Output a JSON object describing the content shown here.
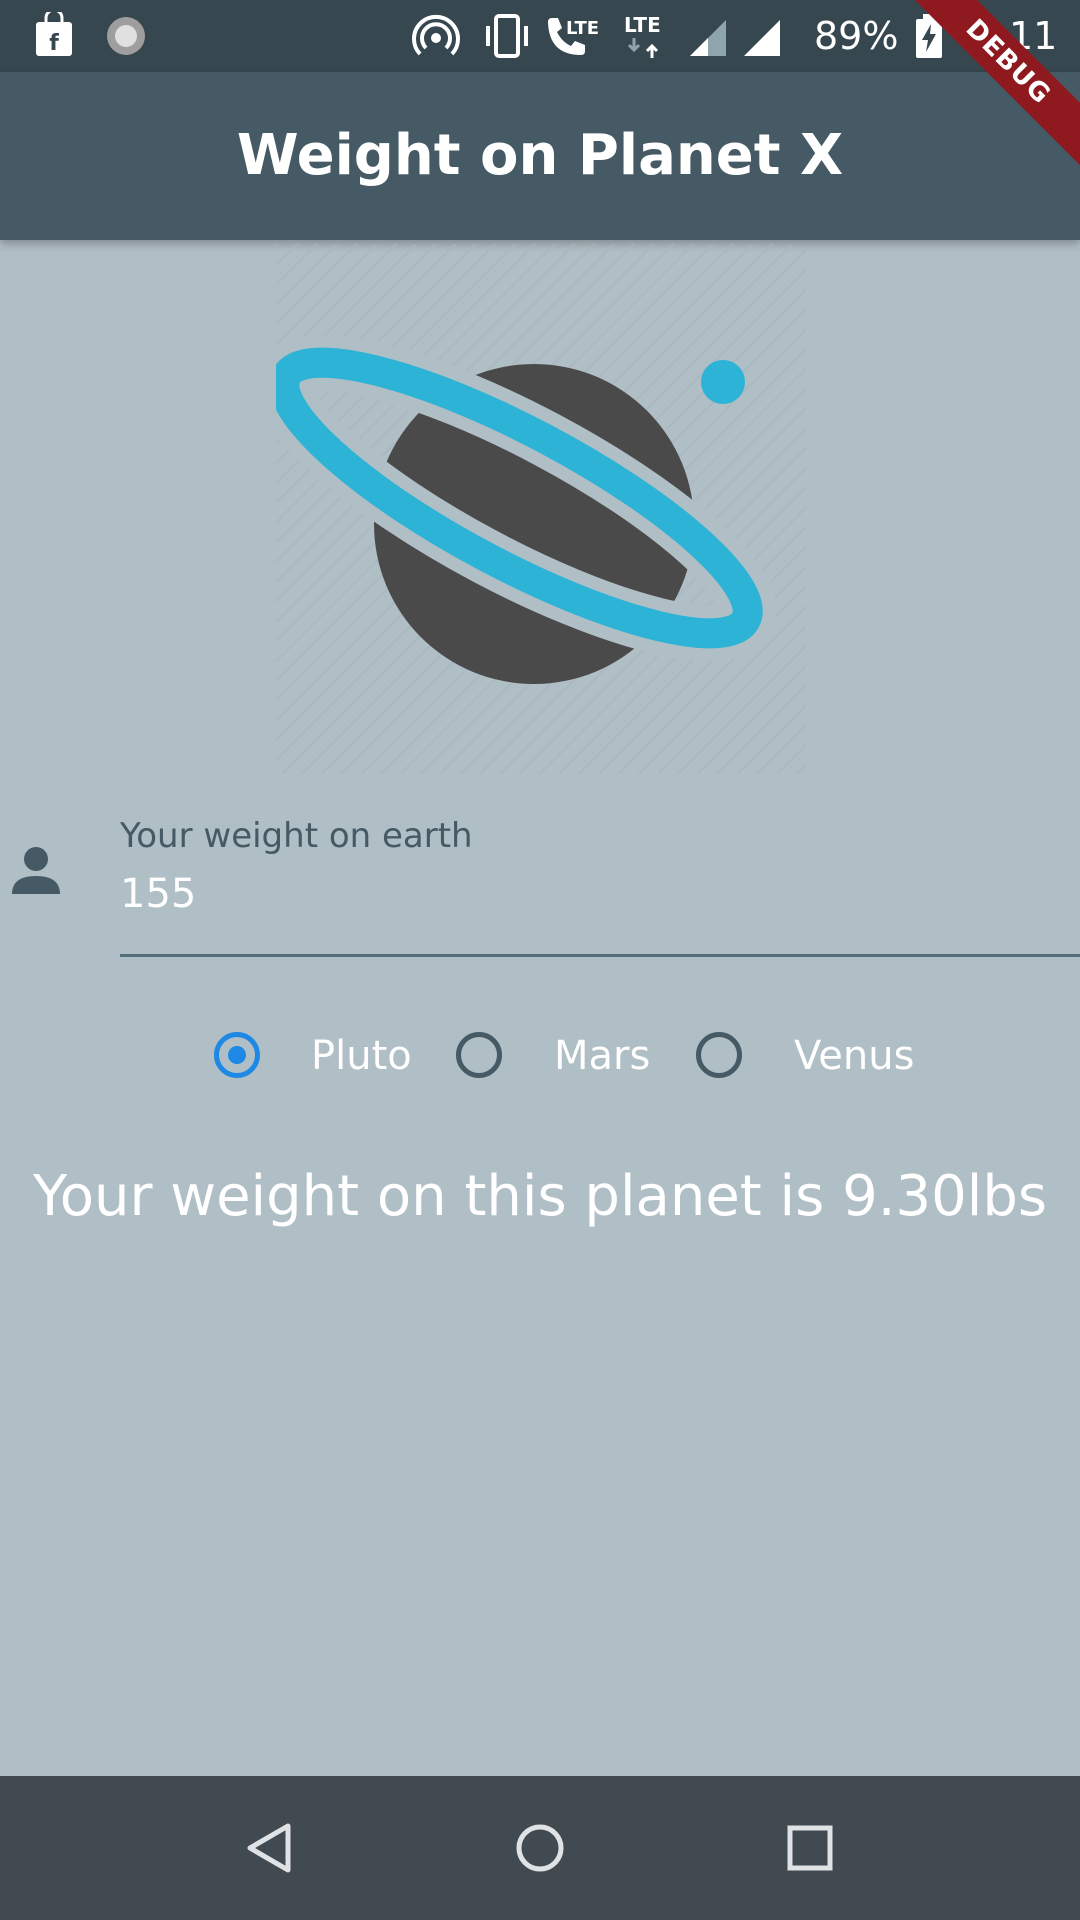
{
  "status_bar": {
    "battery": "89%",
    "time": "8:11",
    "icons": [
      "shopping-bag-icon",
      "loading-spinner-icon",
      "hotspot-icon",
      "vibrate-icon",
      "lte-call-icon",
      "lte-data-icon",
      "signal-icon",
      "signal-full-icon",
      "battery-charging-icon"
    ]
  },
  "debug_banner": "DEBUG",
  "app_bar": {
    "title": "Weight on Planet X"
  },
  "form": {
    "weight_label": "Your weight on earth",
    "weight_value": "155"
  },
  "planets": [
    {
      "label": "Pluto",
      "selected": true
    },
    {
      "label": "Mars",
      "selected": false
    },
    {
      "label": "Venus",
      "selected": false
    }
  ],
  "result": "Your weight on this planet is 9.30lbs",
  "colors": {
    "primary": "#455a64",
    "background": "#b0bec5",
    "accent": "#1e88e5",
    "logo_ring": "#2cb3d6",
    "logo_planet": "#4a4a4a"
  },
  "nav_bar": {
    "icons": [
      "back-icon",
      "home-icon",
      "recents-icon"
    ]
  }
}
